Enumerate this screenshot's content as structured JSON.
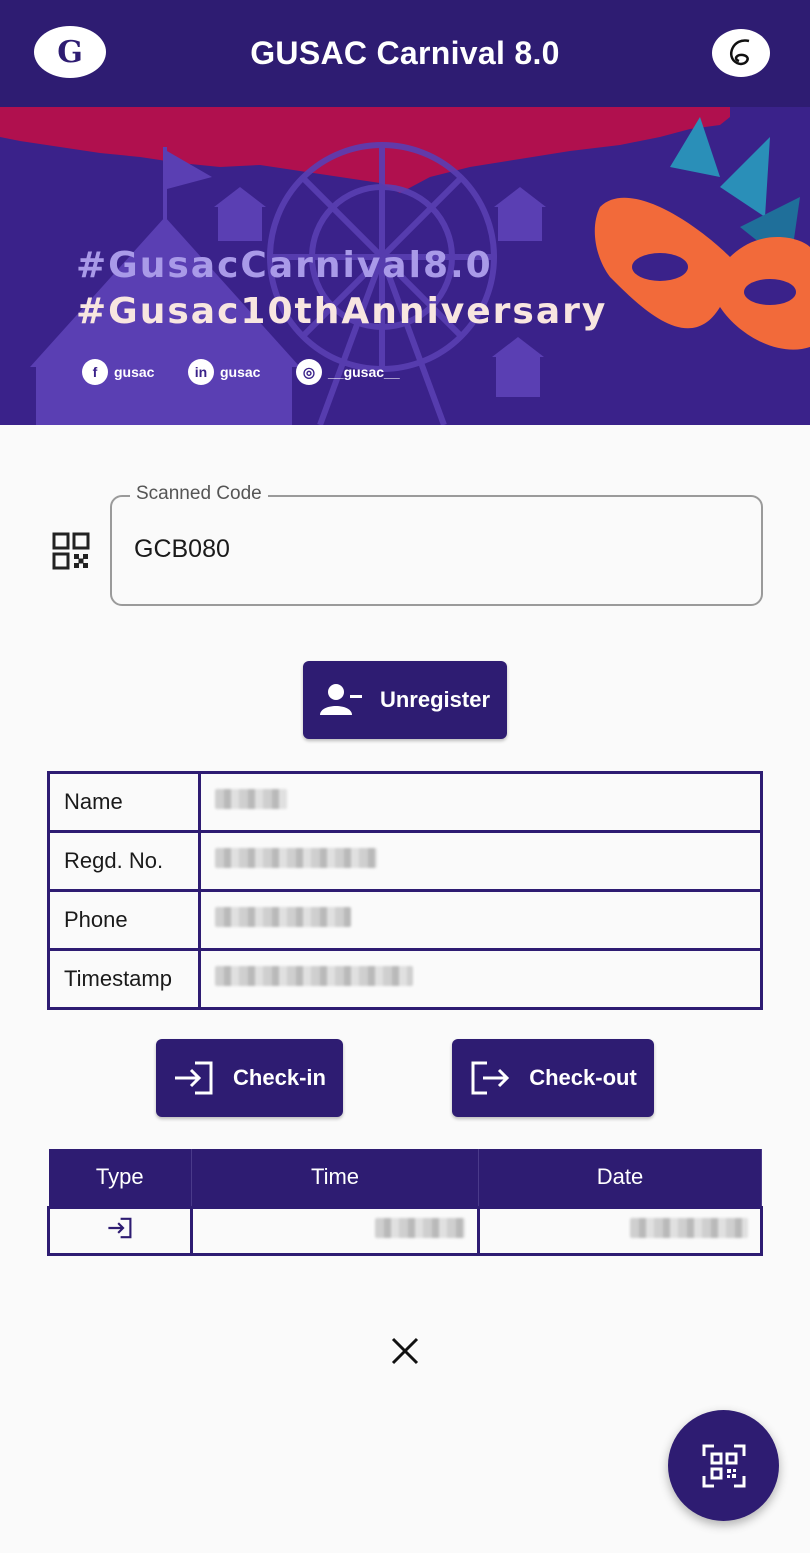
{
  "appbar": {
    "title": "GUSAC Carnival 8.0"
  },
  "banner": {
    "hashtag1": "#GusacCarnival8.0",
    "hashtag2": "#Gusac10thAnniversary",
    "social": [
      {
        "icon": "facebook-icon",
        "glyph": "f",
        "label": "gusac"
      },
      {
        "icon": "linkedin-icon",
        "glyph": "in",
        "label": "gusac"
      },
      {
        "icon": "instagram-icon",
        "glyph": "◎",
        "label": "__gusac__"
      }
    ],
    "colors": {
      "top_strip": "#b0104e",
      "mask": "#f26a3a",
      "feather": "#2a8fb8"
    }
  },
  "scan": {
    "label": "Scanned Code",
    "value": "GCB080"
  },
  "unregister": {
    "label": "Unregister"
  },
  "info": {
    "rows": [
      {
        "key": "Name",
        "value": ""
      },
      {
        "key": "Regd. No.",
        "value": ""
      },
      {
        "key": "Phone",
        "value": ""
      },
      {
        "key": "Timestamp",
        "value": ""
      }
    ]
  },
  "actions": {
    "checkin": "Check-in",
    "checkout": "Check-out"
  },
  "log": {
    "headers": [
      "Type",
      "Time",
      "Date"
    ],
    "rows": [
      {
        "type_icon": "login-icon",
        "time": "",
        "date": ""
      }
    ]
  },
  "colors": {
    "primary": "#2e1c72",
    "background": "#fafafa"
  }
}
